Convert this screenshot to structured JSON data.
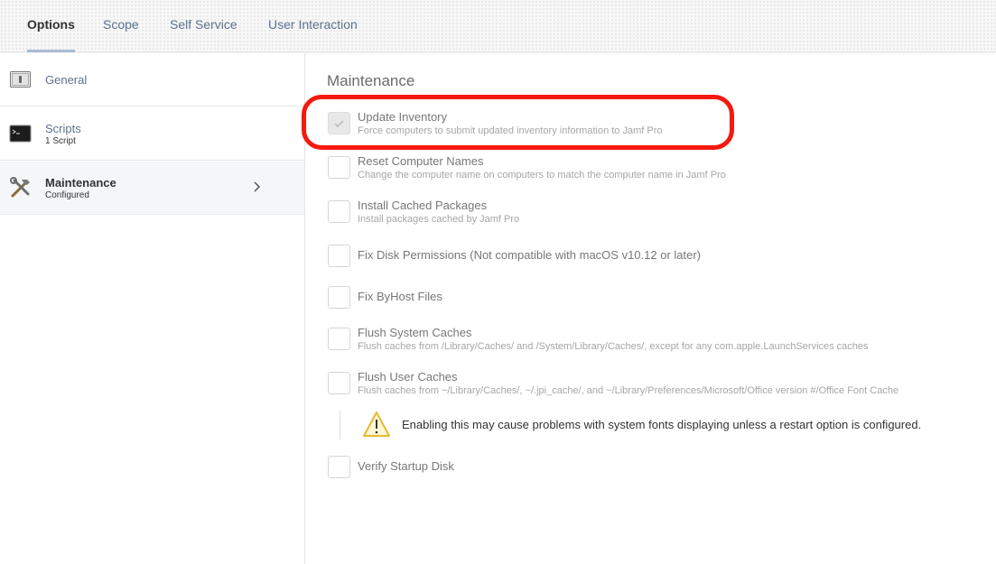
{
  "tabs": [
    {
      "label": "Options"
    },
    {
      "label": "Scope"
    },
    {
      "label": "Self Service"
    },
    {
      "label": "User Interaction"
    }
  ],
  "sidebar": {
    "items": [
      {
        "title": "General",
        "subtitle": "",
        "icon": "general-icon"
      },
      {
        "title": "Scripts",
        "subtitle": "1 Script",
        "icon": "terminal-icon"
      },
      {
        "title": "Maintenance",
        "subtitle": "Configured",
        "icon": "tools-icon"
      }
    ]
  },
  "main": {
    "title": "Maintenance",
    "options": [
      {
        "label": "Update Inventory",
        "description": "Force computers to submit updated inventory information to Jamf Pro",
        "checked": true
      },
      {
        "label": "Reset Computer Names",
        "description": "Change the computer name on computers to match the computer name in Jamf Pro",
        "checked": false
      },
      {
        "label": "Install Cached Packages",
        "description": "Install packages cached by Jamf Pro",
        "checked": false
      },
      {
        "label": "Fix Disk Permissions (Not compatible with macOS v10.12 or later)",
        "description": "",
        "checked": false
      },
      {
        "label": "Fix ByHost Files",
        "description": "",
        "checked": false
      },
      {
        "label": "Flush System Caches",
        "description": "Flush caches from /Library/Caches/ and /System/Library/Caches/, except for any com.apple.LaunchServices caches",
        "checked": false
      },
      {
        "label": "Flush User Caches",
        "description": "Flush caches from ~/Library/Caches/, ~/.jpi_cache/, and ~/Library/Preferences/Microsoft/Office version #/Office Font Cache",
        "checked": false
      },
      {
        "label": "Verify Startup Disk",
        "description": "",
        "checked": false
      }
    ],
    "warning": {
      "text": "Enabling this may cause problems with system fonts displaying unless a restart option is configured.",
      "icon": "warning-triangle-icon"
    }
  },
  "colors": {
    "highlight": "#f5190f",
    "tab_text": "#5b7390",
    "tab_underline": "#a9bbd2",
    "warning": "#e8b92f"
  }
}
